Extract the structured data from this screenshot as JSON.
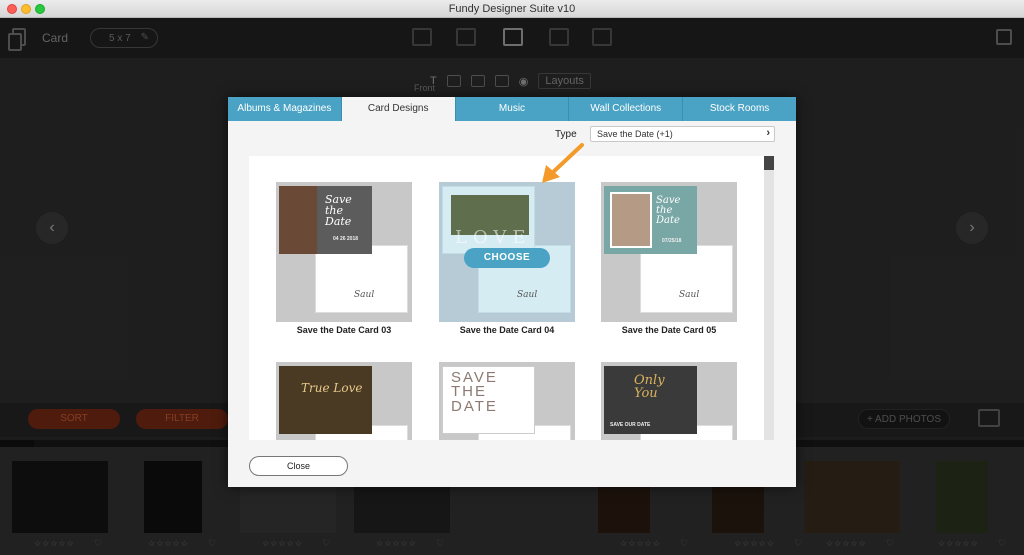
{
  "window": {
    "title": "Fundy Designer Suite v10"
  },
  "toolbar": {
    "mode_label": "Card",
    "size_label": "5 x 7",
    "edit_icon": "pencil-icon"
  },
  "editor": {
    "side_label": "Front",
    "layouts_label": "Layouts"
  },
  "bottombar": {
    "sort_label": "SORT",
    "filter_label": "FILTER",
    "add_photos_label": "+ ADD PHOTOS"
  },
  "filmstrip": {
    "rating_glyphs": "☆☆☆☆☆",
    "heart_glyph": "♡"
  },
  "dialog": {
    "tabs": [
      {
        "label": "Albums & Magazines"
      },
      {
        "label": "Card Designs"
      },
      {
        "label": "Music"
      },
      {
        "label": "Wall Collections"
      },
      {
        "label": "Stock Rooms"
      }
    ],
    "active_tab": "Card Designs",
    "type_label": "Type",
    "type_value": "Save the Date (+1)",
    "choose_label": "CHOOSE",
    "close_label": "Close",
    "designs": [
      {
        "name": "Save the Date Card 03",
        "script": "Save the Date",
        "date": "04 26 2018"
      },
      {
        "name": "Save the Date Card 04",
        "overlay": "LOVE"
      },
      {
        "name": "Save the Date Card 05",
        "script": "Save the Date",
        "date": "07/25/18"
      },
      {
        "name": "",
        "script": "True Love"
      },
      {
        "name": "",
        "overlay": "SAVE THE DATE"
      },
      {
        "name": "",
        "script": "Only You",
        "sub": "SAVE OUR DATE"
      }
    ]
  },
  "colors": {
    "accent": "#4aa3c4",
    "arrow": "#f39a2b",
    "sort_pill": "#7a2a14"
  }
}
